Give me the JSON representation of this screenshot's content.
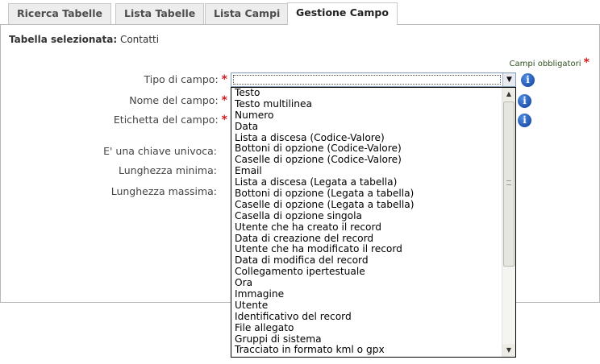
{
  "tabs": [
    {
      "label": "Ricerca Tabelle"
    },
    {
      "label": "Lista Tabelle"
    },
    {
      "label": "Lista Campi"
    },
    {
      "label": "Gestione Campo"
    }
  ],
  "selected_table": {
    "label": "Tabella selezionata:",
    "value": "Contatti"
  },
  "required_note": "Campi obbligatori",
  "required_marker": "*",
  "fields": {
    "tipo": "Tipo di campo:",
    "nome": "Nome del campo:",
    "etichetta": "Etichetta del campo:",
    "chiave": "E' una chiave univoca:",
    "min": "Lunghezza minima:",
    "max": "Lunghezza massima:"
  },
  "select": {
    "value": ""
  },
  "icons": {
    "info": "info-icon",
    "arrow": "chevron-down-icon"
  },
  "options": [
    "Testo",
    "Testo multilinea",
    "Numero",
    "Data",
    "Lista a discesa (Codice-Valore)",
    "Bottoni di opzione (Codice-Valore)",
    "Caselle di opzione (Codice-Valore)",
    "Email",
    "Lista a discesa (Legata a tabella)",
    "Bottoni di opzione (Legata a tabella)",
    "Caselle di opzione (Legata a tabella)",
    "Casella di opzione singola",
    "Utente che ha creato il record",
    "Data di creazione del record",
    "Utente che ha modificato il record",
    "Data di modifica del record",
    "Collegamento ipertestuale",
    "Ora",
    "Immagine",
    "Utente",
    "Identificativo del record",
    "File allegato",
    "Gruppi di sistema",
    "Tracciato in formato kml o gpx"
  ],
  "colors": {
    "required": "#d01c1c",
    "info": "#1a4fb0"
  }
}
